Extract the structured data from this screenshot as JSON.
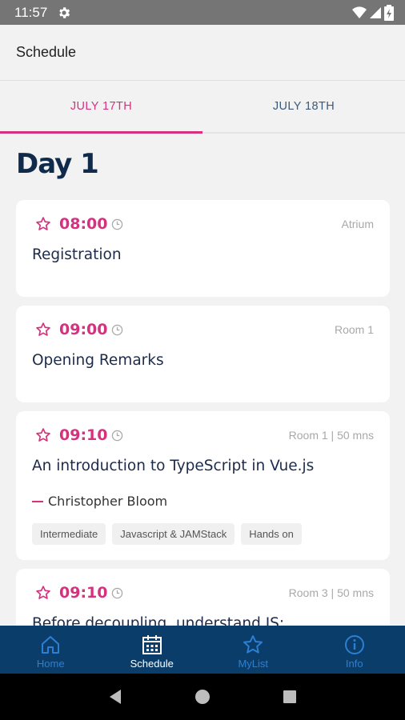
{
  "status_bar": {
    "time": "11:57",
    "icons": [
      "settings-icon",
      "wifi-icon",
      "signal-icon",
      "battery-icon"
    ]
  },
  "app_bar": {
    "title": "Schedule"
  },
  "tabs": [
    {
      "label": "JULY 17TH",
      "active": true
    },
    {
      "label": "JULY 18TH",
      "active": false
    }
  ],
  "day_title": "Day 1",
  "sessions": [
    {
      "time": "08:00",
      "room": "Atrium",
      "title": "Registration"
    },
    {
      "time": "09:00",
      "room": "Room 1",
      "title": "Opening Remarks"
    },
    {
      "time": "09:10",
      "room": "Room 1 | 50 mns",
      "title": "An introduction to TypeScript in Vue.js",
      "speaker": "Christopher Bloom",
      "tags": [
        "Intermediate",
        "Javascript & JAMStack",
        "Hands on"
      ]
    },
    {
      "time": "09:10",
      "room": "Room 3 | 50 mns",
      "title": "Before decoupling, understand JS:"
    }
  ],
  "bottom_nav": [
    {
      "label": "Home",
      "icon": "home-icon",
      "active": false
    },
    {
      "label": "Schedule",
      "icon": "calendar-icon",
      "active": true
    },
    {
      "label": "MyList",
      "icon": "star-icon",
      "active": false
    },
    {
      "label": "Info",
      "icon": "info-icon",
      "active": false
    }
  ],
  "colors": {
    "accent": "#d6317f",
    "navy": "#0b3d6b",
    "title": "#0f2a4a"
  }
}
